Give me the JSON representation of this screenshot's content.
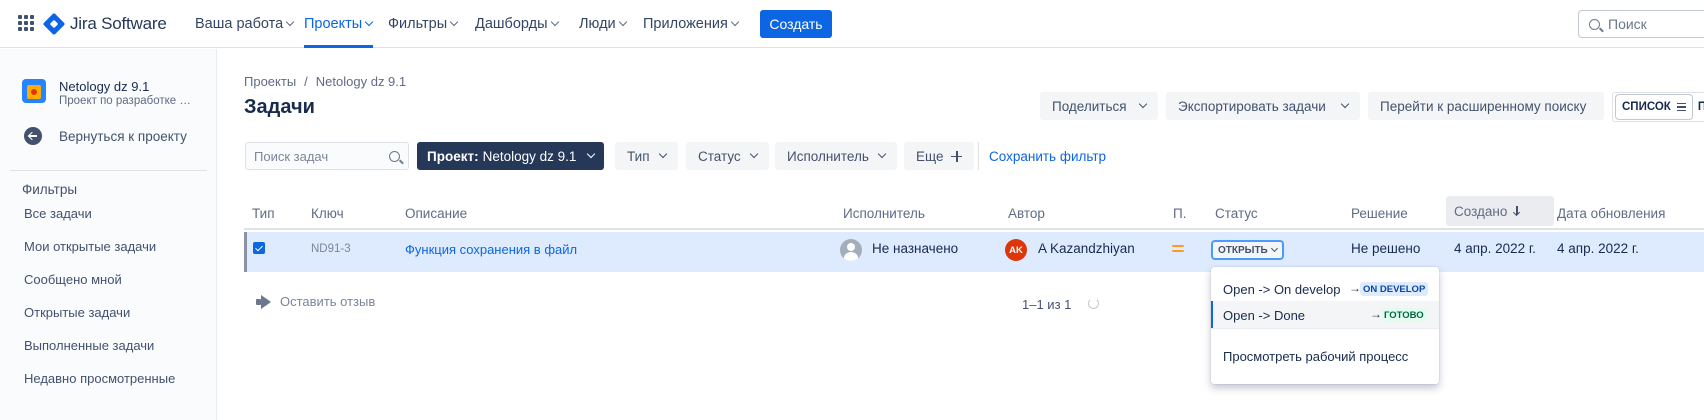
{
  "topnav": {
    "logo_text": "Jira Software",
    "items": [
      {
        "label": "Ваша работа"
      },
      {
        "label": "Проекты"
      },
      {
        "label": "Фильтры"
      },
      {
        "label": "Дашборды"
      },
      {
        "label": "Люди"
      },
      {
        "label": "Приложения"
      }
    ],
    "active_index": 1,
    "create_label": "Создать",
    "search_placeholder": "Поиск"
  },
  "sidebar": {
    "project_name": "Netology dz 9.1",
    "project_subtitle": "Проект по разработке …",
    "back_label": "Вернуться к проекту",
    "filters_heading": "Фильтры",
    "items": [
      {
        "label": "Все задачи"
      },
      {
        "label": "Мои открытые задачи"
      },
      {
        "label": "Сообщено мной"
      },
      {
        "label": "Открытые задачи"
      },
      {
        "label": "Выполненные задачи"
      },
      {
        "label": "Недавно просмотренные"
      }
    ]
  },
  "main": {
    "breadcrumb": [
      "Проекты",
      "/",
      "Netology dz 9.1"
    ],
    "title": "Задачи",
    "actions": {
      "share": "Поделиться",
      "export": "Экспортировать задачи",
      "advanced_search": "Перейти к расширенному поиску"
    },
    "view_toggle": {
      "list": "СПИСОК",
      "other": "П"
    },
    "filters": {
      "search_placeholder": "Поиск задач",
      "project_prefix": "Проект:",
      "project_value": "Netology dz 9.1",
      "type": "Тип",
      "status": "Статус",
      "assignee": "Исполнитель",
      "more": "Еще",
      "save_filter": "Сохранить фильтр"
    },
    "table": {
      "columns": [
        "Тип",
        "Ключ",
        "Описание",
        "Исполнитель",
        "Автор",
        "П.",
        "Статус",
        "Решение",
        "Создано",
        "Дата обновления"
      ],
      "sorted_column": "Создано",
      "rows": [
        {
          "key": "ND91-3",
          "summary": "Функция сохранения в файл",
          "assignee": "Не назначено",
          "author_initials": "AK",
          "author": "A Kazandzhiyan",
          "priority": "medium",
          "status": "ОТКРЫТЬ",
          "resolution": "Не решено",
          "created": "4 апр. 2022 г.",
          "updated": "4 апр. 2022 г."
        }
      ]
    },
    "feedback": "Оставить отзыв",
    "pagination": "1–1 из 1"
  },
  "status_dropdown": {
    "transitions": [
      {
        "label": "Open -> On develop",
        "arrow": "→",
        "target": "ON DEVELOP"
      },
      {
        "label": "Open -> Done",
        "arrow": "→",
        "target": "ГОТОВО"
      }
    ],
    "view_workflow": "Просмотреть рабочий процесс"
  },
  "colors": {
    "accent": "#0c66e4",
    "selected_row": "#deebff",
    "project_filter_bg": "#253858",
    "author_avatar": "#de350b",
    "priority_medium": "#ff991f"
  }
}
